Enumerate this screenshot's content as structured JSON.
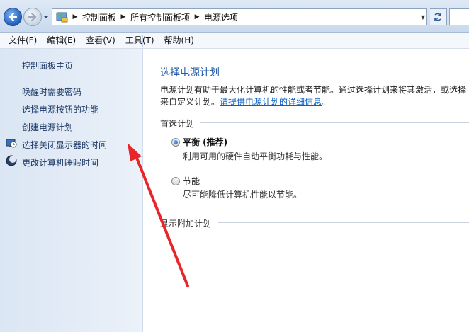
{
  "address_bar": {
    "crumbs": [
      "控制面板",
      "所有控制面板项",
      "电源选项"
    ]
  },
  "menu": {
    "items": [
      "文件(F)",
      "编辑(E)",
      "查看(V)",
      "工具(T)",
      "帮助(H)"
    ]
  },
  "sidebar": {
    "home": "控制面板主页",
    "links": [
      {
        "label": "唤醒时需要密码",
        "icon": ""
      },
      {
        "label": "选择电源按钮的功能",
        "icon": ""
      },
      {
        "label": "创建电源计划",
        "icon": ""
      },
      {
        "label": "选择关闭显示器的时间",
        "icon": "monitor-clock-icon"
      },
      {
        "label": "更改计算机睡眠时间",
        "icon": "moon-icon"
      }
    ]
  },
  "main": {
    "title": "选择电源计划",
    "desc_line1": "电源计划有助于最大化计算机的性能或者节能。通过选择计划来将其激活，或选择",
    "desc_line2_text": "来自定义计划。",
    "desc_link": "请提供电源计划的详细信息",
    "desc_line2_end": "。",
    "preferred_header": "首选计划",
    "plans": [
      {
        "name": "平衡 (推荐)",
        "desc": "利用可用的硬件自动平衡功耗与性能。",
        "selected": true
      },
      {
        "name": "节能",
        "desc": "尽可能降低计算机性能以节能。",
        "selected": false
      }
    ],
    "additional_header": "显示附加计划"
  },
  "colors": {
    "link": "#1d3a66",
    "title": "#1e5aa8",
    "hyperlink": "#0a5fc4",
    "annotation_arrow": "#e8262a"
  }
}
